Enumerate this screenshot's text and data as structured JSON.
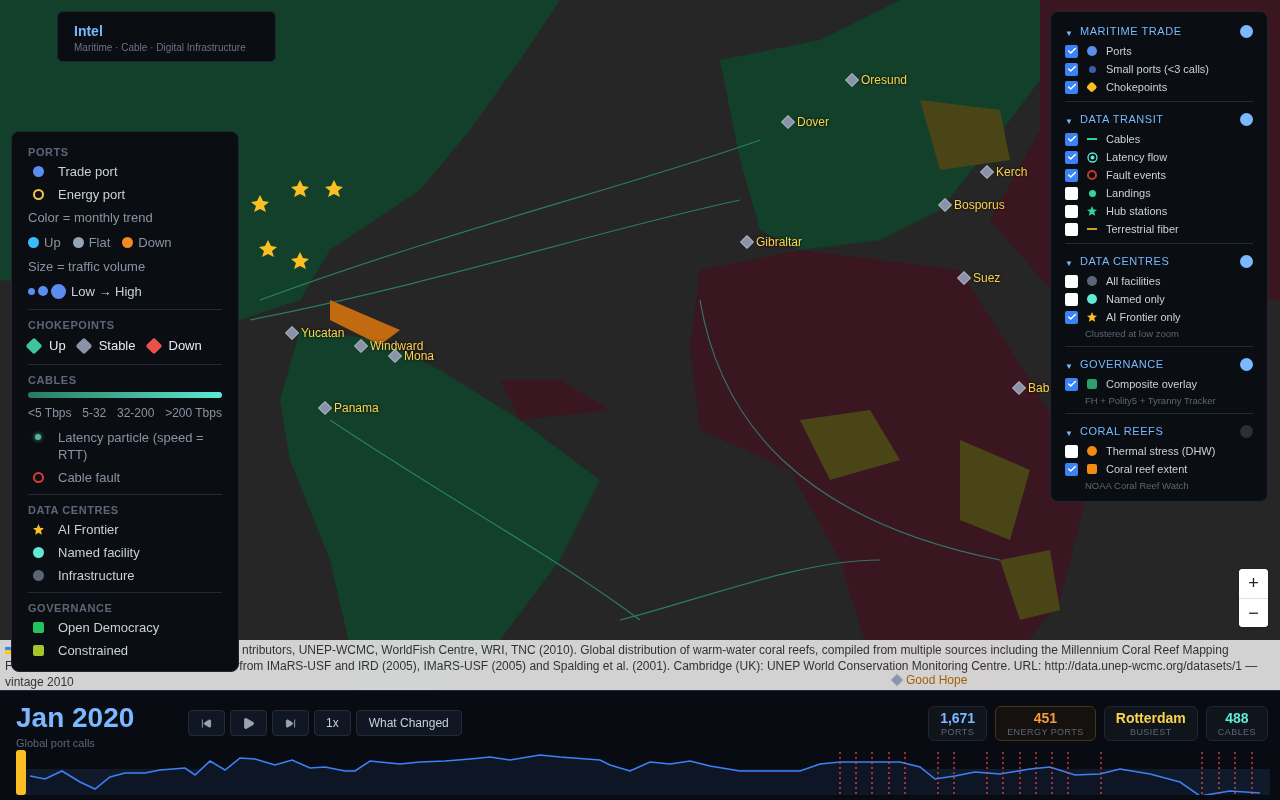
{
  "brand": {
    "title": "Intel",
    "subtitle": "Maritime · Cable · Digital Infrastructure"
  },
  "chokepoints": [
    {
      "label": "Oresund"
    },
    {
      "label": "Dover"
    },
    {
      "label": "Kerch"
    },
    {
      "label": "Bosporus"
    },
    {
      "label": "Gibraltar"
    },
    {
      "label": "Suez"
    },
    {
      "label": "Yucatan"
    },
    {
      "label": "Windward"
    },
    {
      "label": "Mona"
    },
    {
      "label": "Panama"
    },
    {
      "label": "Bab"
    },
    {
      "label": "Good Hope"
    }
  ],
  "legend": [
    {
      "title": "PORTS",
      "entries": [
        {
          "kind": "dot",
          "color": "#5b8def",
          "label": "Trade port"
        },
        {
          "kind": "ring",
          "color": "#f5c542",
          "label": "Energy port"
        },
        {
          "kind": "note",
          "text": "Color = monthly trend"
        },
        {
          "kind": "inline",
          "items": [
            {
              "kind": "dot",
              "color": "#38bdf8",
              "label": "Up"
            },
            {
              "kind": "dot",
              "color": "#94a3b8",
              "label": "Flat"
            },
            {
              "kind": "dot",
              "color": "#f08a24",
              "label": "Down"
            }
          ]
        },
        {
          "kind": "note",
          "text": "Size = traffic volume"
        },
        {
          "kind": "scale",
          "label": "Low → High"
        }
      ]
    },
    {
      "title": "CHOKEPOINTS",
      "entries": [
        {
          "kind": "inline",
          "items": [
            {
              "kind": "diamond",
              "color": "#3ec5a0",
              "label": "Up"
            },
            {
              "kind": "diamond",
              "color": "#8b93a8",
              "label": "Stable"
            },
            {
              "kind": "diamond",
              "color": "#e5534b",
              "label": "Down"
            }
          ]
        }
      ]
    },
    {
      "title": "CABLES",
      "entries": [
        {
          "kind": "gradient",
          "labels": [
            "<5 Tbps",
            "5-32",
            "32-200",
            ">200 Tbps"
          ]
        },
        {
          "kind": "particle",
          "color": "#4fb89a",
          "label": "Latency particle (speed = RTT)"
        },
        {
          "kind": "fault",
          "color": "#d63a3a",
          "label": "Cable fault"
        }
      ]
    },
    {
      "title": "DATA CENTRES",
      "entries": [
        {
          "kind": "star",
          "color": "#fbbf24",
          "label": "AI Frontier"
        },
        {
          "kind": "dot",
          "color": "#5eead4",
          "label": "Named facility"
        },
        {
          "kind": "dot",
          "color": "#5c6577",
          "label": "Infrastructure"
        }
      ]
    },
    {
      "title": "GOVERNANCE",
      "entries": [
        {
          "kind": "square",
          "color": "#22c55e",
          "label": "Open Democracy"
        },
        {
          "kind": "square",
          "color": "#a3c62b",
          "label": "Constrained"
        }
      ]
    }
  ],
  "attribution": [
    "ntributors, UNEP-WCMC, WorldFish Centre, WRI, TNC (2010). Global distribution of warm-water coral reefs, compiled from multiple sources including the Millennium Coral Reef Mapping",
    "F",
    "from IMaRS-USF and IRD (2005), IMaRS-USF (2005) and Spalding et al. (2001). Cambridge (UK): UNEP World Conservation Monitoring Centre. URL: http://data.unep-wcmc.org/datasets/1 —",
    "vintage 2010"
  ],
  "layers": [
    {
      "caret": "▼",
      "title": "MARITIME TRADE",
      "on": true,
      "items": [
        {
          "checked": true,
          "kind": "dot",
          "color": "#5b8def",
          "label": "Ports"
        },
        {
          "checked": true,
          "kind": "smalldot",
          "color": "#3b5ea8",
          "label": "Small ports (<3 calls)"
        },
        {
          "checked": true,
          "kind": "diamond",
          "color": "#fbbf24",
          "label": "Chokepoints"
        }
      ]
    },
    {
      "caret": "▼",
      "title": "DATA TRANSIT",
      "on": true,
      "items": [
        {
          "checked": true,
          "kind": "line",
          "color": "#2dd4a0",
          "label": "Cables"
        },
        {
          "checked": true,
          "kind": "target",
          "color": "#5eead4",
          "label": "Latency flow"
        },
        {
          "checked": true,
          "kind": "ring",
          "color": "#c0392b",
          "label": "Fault events"
        },
        {
          "checked": false,
          "kind": "smalldot",
          "color": "#34d399",
          "label": "Landings"
        },
        {
          "checked": false,
          "kind": "star",
          "color": "#34d399",
          "label": "Hub stations"
        },
        {
          "checked": false,
          "kind": "line",
          "color": "#c9a227",
          "label": "Terrestrial fiber"
        }
      ]
    },
    {
      "caret": "▼",
      "title": "DATA CENTRES",
      "on": true,
      "items": [
        {
          "checked": false,
          "kind": "dot",
          "color": "#5c6577",
          "label": "All facilities"
        },
        {
          "checked": false,
          "kind": "dot",
          "color": "#5eead4",
          "label": "Named only"
        },
        {
          "checked": true,
          "kind": "star",
          "color": "#fbbf24",
          "label": "AI Frontier only"
        }
      ],
      "note": "Clustered at low zoom"
    },
    {
      "caret": "▼",
      "title": "GOVERNANCE",
      "on": true,
      "items": [
        {
          "checked": true,
          "kind": "square",
          "color": "#2e9e6e",
          "label": "Composite overlay"
        }
      ],
      "note": "FH + Polity5 + Tyranny Tracker"
    },
    {
      "caret": "▼",
      "title": "CORAL REEFS",
      "on": false,
      "items": [
        {
          "checked": false,
          "kind": "dot",
          "color": "#f08a10",
          "label": "Thermal stress (DHW)"
        },
        {
          "checked": true,
          "kind": "square",
          "color": "#f08a10",
          "label": "Coral reef extent"
        }
      ],
      "note": "NOAA Coral Reef Watch"
    }
  ],
  "zoom": [
    "+",
    "−"
  ],
  "timeline": {
    "date": "Jan 2020",
    "caption": "Global port calls",
    "speed": "1x",
    "what_changed": "What Changed",
    "level": 0
  },
  "stats": [
    {
      "value": "1,671",
      "label": "PORTS",
      "color": "#7ab8ff"
    },
    {
      "value": "451",
      "label": "ENERGY PORTS",
      "color": "#f5993b"
    },
    {
      "value": "Rotterdam",
      "label": "BUSIEST",
      "color": "#fcd34d"
    },
    {
      "value": "488",
      "label": "CABLES",
      "color": "#5eead4"
    }
  ]
}
